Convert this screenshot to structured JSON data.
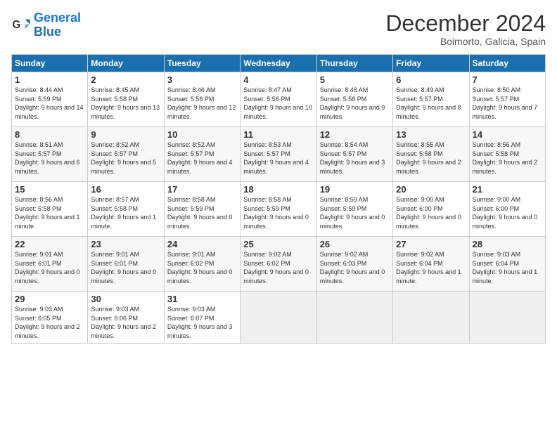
{
  "header": {
    "logo_general": "General",
    "logo_blue": "Blue",
    "month": "December 2024",
    "location": "Boimorto, Galicia, Spain"
  },
  "weekdays": [
    "Sunday",
    "Monday",
    "Tuesday",
    "Wednesday",
    "Thursday",
    "Friday",
    "Saturday"
  ],
  "weeks": [
    [
      {
        "day": 1,
        "sunrise": "8:44 AM",
        "sunset": "5:59 PM",
        "daylight": "9 hours and 14 minutes."
      },
      {
        "day": 2,
        "sunrise": "8:45 AM",
        "sunset": "5:58 PM",
        "daylight": "9 hours and 13 minutes."
      },
      {
        "day": 3,
        "sunrise": "8:46 AM",
        "sunset": "5:58 PM",
        "daylight": "9 hours and 12 minutes."
      },
      {
        "day": 4,
        "sunrise": "8:47 AM",
        "sunset": "5:58 PM",
        "daylight": "9 hours and 10 minutes."
      },
      {
        "day": 5,
        "sunrise": "8:48 AM",
        "sunset": "5:58 PM",
        "daylight": "9 hours and 9 minutes."
      },
      {
        "day": 6,
        "sunrise": "8:49 AM",
        "sunset": "5:57 PM",
        "daylight": "9 hours and 8 minutes."
      },
      {
        "day": 7,
        "sunrise": "8:50 AM",
        "sunset": "5:57 PM",
        "daylight": "9 hours and 7 minutes."
      }
    ],
    [
      {
        "day": 8,
        "sunrise": "8:51 AM",
        "sunset": "5:57 PM",
        "daylight": "9 hours and 6 minutes."
      },
      {
        "day": 9,
        "sunrise": "8:52 AM",
        "sunset": "5:57 PM",
        "daylight": "9 hours and 5 minutes."
      },
      {
        "day": 10,
        "sunrise": "8:52 AM",
        "sunset": "5:57 PM",
        "daylight": "9 hours and 4 minutes."
      },
      {
        "day": 11,
        "sunrise": "8:53 AM",
        "sunset": "5:57 PM",
        "daylight": "9 hours and 4 minutes."
      },
      {
        "day": 12,
        "sunrise": "8:54 AM",
        "sunset": "5:57 PM",
        "daylight": "9 hours and 3 minutes."
      },
      {
        "day": 13,
        "sunrise": "8:55 AM",
        "sunset": "5:58 PM",
        "daylight": "9 hours and 2 minutes."
      },
      {
        "day": 14,
        "sunrise": "8:56 AM",
        "sunset": "5:58 PM",
        "daylight": "9 hours and 2 minutes."
      }
    ],
    [
      {
        "day": 15,
        "sunrise": "8:56 AM",
        "sunset": "5:58 PM",
        "daylight": "9 hours and 1 minute."
      },
      {
        "day": 16,
        "sunrise": "8:57 AM",
        "sunset": "5:58 PM",
        "daylight": "9 hours and 1 minute."
      },
      {
        "day": 17,
        "sunrise": "8:58 AM",
        "sunset": "5:59 PM",
        "daylight": "9 hours and 0 minutes."
      },
      {
        "day": 18,
        "sunrise": "8:58 AM",
        "sunset": "5:59 PM",
        "daylight": "9 hours and 0 minutes."
      },
      {
        "day": 19,
        "sunrise": "8:59 AM",
        "sunset": "5:59 PM",
        "daylight": "9 hours and 0 minutes."
      },
      {
        "day": 20,
        "sunrise": "9:00 AM",
        "sunset": "6:00 PM",
        "daylight": "9 hours and 0 minutes."
      },
      {
        "day": 21,
        "sunrise": "9:00 AM",
        "sunset": "6:00 PM",
        "daylight": "9 hours and 0 minutes."
      }
    ],
    [
      {
        "day": 22,
        "sunrise": "9:01 AM",
        "sunset": "6:01 PM",
        "daylight": "9 hours and 0 minutes."
      },
      {
        "day": 23,
        "sunrise": "9:01 AM",
        "sunset": "6:01 PM",
        "daylight": "9 hours and 0 minutes."
      },
      {
        "day": 24,
        "sunrise": "9:01 AM",
        "sunset": "6:02 PM",
        "daylight": "9 hours and 0 minutes."
      },
      {
        "day": 25,
        "sunrise": "9:02 AM",
        "sunset": "6:02 PM",
        "daylight": "9 hours and 0 minutes."
      },
      {
        "day": 26,
        "sunrise": "9:02 AM",
        "sunset": "6:03 PM",
        "daylight": "9 hours and 0 minutes."
      },
      {
        "day": 27,
        "sunrise": "9:02 AM",
        "sunset": "6:04 PM",
        "daylight": "9 hours and 1 minute."
      },
      {
        "day": 28,
        "sunrise": "9:03 AM",
        "sunset": "6:04 PM",
        "daylight": "9 hours and 1 minute."
      }
    ],
    [
      {
        "day": 29,
        "sunrise": "9:03 AM",
        "sunset": "6:05 PM",
        "daylight": "9 hours and 2 minutes."
      },
      {
        "day": 30,
        "sunrise": "9:03 AM",
        "sunset": "6:06 PM",
        "daylight": "9 hours and 2 minutes."
      },
      {
        "day": 31,
        "sunrise": "9:03 AM",
        "sunset": "6:07 PM",
        "daylight": "9 hours and 3 minutes."
      },
      null,
      null,
      null,
      null
    ]
  ]
}
